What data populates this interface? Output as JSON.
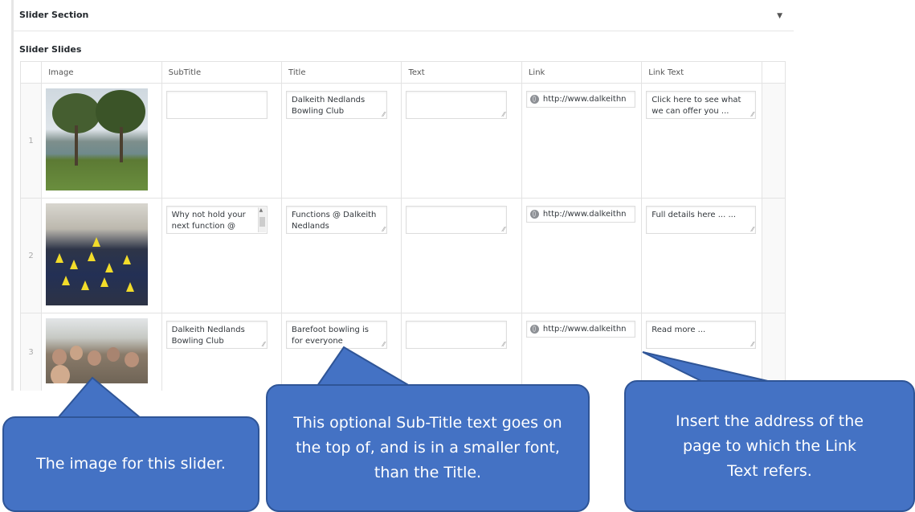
{
  "section": {
    "title": "Slider Section",
    "toggle_icon": "triangle-down-icon"
  },
  "slides_label": "Slider Slides",
  "columns": [
    "Image",
    "SubTitle",
    "Title",
    "Text",
    "Link",
    "Link Text"
  ],
  "rows": [
    {
      "order": "1",
      "image": "lakeside-trees-photo",
      "subtitle": "",
      "title": "Dalkeith Nedlands Bowling Club",
      "text": "",
      "link": "http://www.dalkeithn",
      "link_text": "Click here to see what we can offer you ..."
    },
    {
      "order": "2",
      "image": "function-room-photo",
      "subtitle": "Why not hold your next function @",
      "title": "Functions @ Dalkeith Nedlands",
      "text": "",
      "link": "http://www.dalkeithn",
      "link_text": "Full details here ... ..."
    },
    {
      "order": "3",
      "image": "clubhouse-crowd-photo",
      "subtitle": "Dalkeith Nedlands Bowling Club",
      "title": "Barefoot bowling is for everyone",
      "text": "",
      "link": "http://www.dalkeithn",
      "link_text": "Read more ..."
    }
  ],
  "callouts": {
    "image": "The image for this slider.",
    "subtitle": "This optional Sub-Title text goes on the top of, and is in a smaller font, than the Title.",
    "link": "Insert the address of the page to which the Link Text refers."
  },
  "colors": {
    "callout_fill": "#4472c4",
    "callout_border": "#2f5597"
  }
}
